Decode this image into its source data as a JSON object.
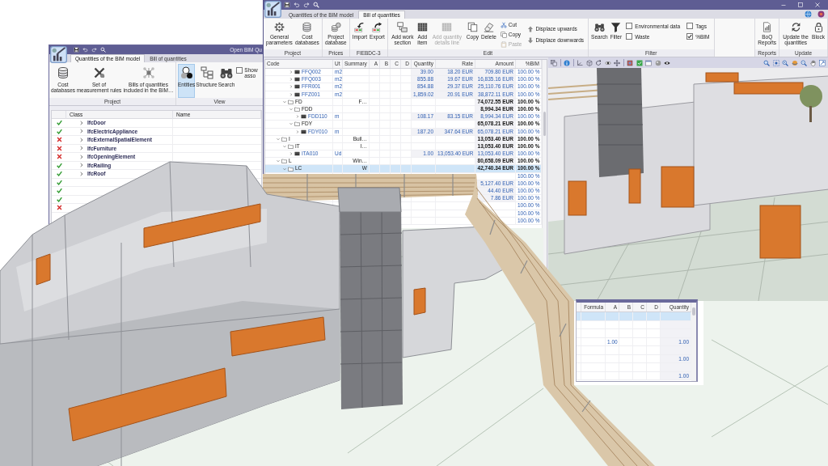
{
  "left_window": {
    "title": "Open BIM Qu",
    "tabs": [
      {
        "label": "Quantities of the BIM model",
        "selected": true
      },
      {
        "label": "Bill of quantities",
        "selected": false
      }
    ],
    "ribbon": [
      {
        "label": "Project",
        "buttons": [
          {
            "label": "Cost databases"
          },
          {
            "label": "Set of measurement rules"
          },
          {
            "label": "Bills of quantities included in the BIM…"
          }
        ]
      },
      {
        "label": "View",
        "buttons": [
          {
            "label": "Entities",
            "selected": true
          },
          {
            "label": "Structure",
            "selected": false
          },
          {
            "label": "Search",
            "selected": false
          }
        ],
        "checkbox": {
          "label": "Show asso",
          "checked": false
        }
      }
    ],
    "table": {
      "columns": [
        "Class",
        "Name"
      ],
      "rows": [
        {
          "valid": true,
          "expanded": false,
          "class": "IfcDoor"
        },
        {
          "valid": true,
          "expanded": false,
          "class": "IfcElectricAppliance"
        },
        {
          "valid": false,
          "expanded": false,
          "class": "IfcExternalSpatialElement"
        },
        {
          "valid": false,
          "expanded": false,
          "class": "IfcFurniture"
        },
        {
          "valid": false,
          "expanded": false,
          "class": "IfcOpeningElement"
        },
        {
          "valid": true,
          "expanded": false,
          "class": "IfcRailing"
        },
        {
          "valid": true,
          "expanded": false,
          "class": "IfcRoof"
        },
        {
          "valid": true
        },
        {
          "valid": true
        },
        {
          "valid": true
        },
        {
          "valid": false
        }
      ]
    }
  },
  "right_window": {
    "tabs": [
      {
        "label": "Quantities of the BIM model",
        "selected": false
      },
      {
        "label": "Bill of quantities",
        "selected": true
      }
    ],
    "ribbon": [
      {
        "label": "Project",
        "buttons": [
          {
            "label": "General parameters"
          },
          {
            "label": "Cost databases"
          }
        ]
      },
      {
        "label": "Prices",
        "buttons": [
          {
            "label": "Project database"
          }
        ]
      },
      {
        "label": "FIEBDC-3",
        "buttons": [
          {
            "label": "Import"
          },
          {
            "label": "Export"
          }
        ]
      },
      {
        "label": "Edit",
        "buttons": [
          {
            "label": "Add work section",
            "disabled": false
          },
          {
            "label": "Add item",
            "disabled": false
          },
          {
            "label": "Add quantity details line",
            "disabled": true
          },
          {
            "label": "Copy",
            "disabled": false
          },
          {
            "label": "Delete",
            "disabled": false
          }
        ],
        "small_buttons": [
          {
            "label": "Cut",
            "disabled": false
          },
          {
            "label": "Copy",
            "disabled": false
          },
          {
            "label": "Paste",
            "disabled": true
          }
        ],
        "move_buttons": [
          {
            "label": "Displace upwards"
          },
          {
            "label": "Displace downwards"
          }
        ]
      },
      {
        "label": "Filter",
        "buttons": [
          {
            "label": "Search"
          },
          {
            "label": "Filter"
          }
        ],
        "checkboxes": [
          {
            "label": "Environmental data",
            "checked": false
          },
          {
            "label": "Waste",
            "checked": false
          },
          {
            "label": "Tags",
            "checked": false
          },
          {
            "label": "%BIM",
            "checked": true
          }
        ]
      },
      {
        "label": "Reports",
        "buttons": [
          {
            "label": "BoQ Reports"
          }
        ]
      },
      {
        "label": "Update",
        "buttons": [
          {
            "label": "Update the quantities"
          },
          {
            "label": "Block"
          }
        ]
      }
    ],
    "table": {
      "columns": [
        "Code",
        "Ut",
        "Summary",
        "A",
        "B",
        "C",
        "D",
        "Quantity",
        "Rate",
        "Amount",
        "%BIM"
      ],
      "tree": [
        {
          "children": [
            {
              "children": [
                {
                  "kind": "item",
                  "expanded": false,
                  "selected": false,
                  "code": "FFQ002",
                  "ut": "m2",
                  "quantity": "39.00",
                  "rate": "18.20 EUR",
                  "amount": "709.80 EUR",
                  "bim": "100.00 %"
                },
                {
                  "kind": "item",
                  "expanded": false,
                  "selected": false,
                  "code": "FFQ003",
                  "ut": "m2",
                  "quantity": "855.88",
                  "rate": "19.67 EUR",
                  "amount": "16,835.16 EUR",
                  "bim": "100.00 %"
                },
                {
                  "kind": "item",
                  "expanded": false,
                  "selected": false,
                  "code": "FFR001",
                  "ut": "m2",
                  "quantity": "854.88",
                  "rate": "29.37 EUR",
                  "amount": "25,110.76 EUR",
                  "bim": "100.00 %"
                },
                {
                  "kind": "item",
                  "expanded": false,
                  "selected": false,
                  "code": "FFZ001",
                  "ut": "m2",
                  "quantity": "1,859.02",
                  "rate": "20.91 EUR",
                  "amount": "38,872.11 EUR",
                  "bim": "100.00 %"
                }
              ]
            },
            {
              "kind": "chapter",
              "expanded": true,
              "selected": false,
              "code": "FD",
              "summary": "F…",
              "amount": "74,072.55 EUR",
              "bim": "100.00 %",
              "children": [
                {
                  "kind": "chapter",
                  "expanded": true,
                  "selected": false,
                  "code": "FDD",
                  "amount": "8,994.34 EUR",
                  "bim": "100.00 %",
                  "children": [
                    {
                      "kind": "item",
                      "expanded": false,
                      "selected": false,
                      "code": "FDD110",
                      "ut": "m",
                      "quantity": "108.17",
                      "rate": "83.15 EUR",
                      "amount": "8,994.34 EUR",
                      "bim": "100.00 %"
                    }
                  ]
                },
                {
                  "kind": "chapter",
                  "expanded": true,
                  "selected": false,
                  "code": "FDY",
                  "amount": "65,078.21 EUR",
                  "bim": "100.00 %",
                  "children": [
                    {
                      "kind": "item",
                      "expanded": false,
                      "selected": false,
                      "code": "FDY010",
                      "ut": "m",
                      "quantity": "187.20",
                      "rate": "347.64 EUR",
                      "amount": "65,078.21 EUR",
                      "bim": "100.00 %"
                    }
                  ]
                }
              ]
            }
          ]
        },
        {
          "kind": "chapter",
          "expanded": true,
          "selected": false,
          "code": "I",
          "summary": "Buil…",
          "amount": "13,053.40 EUR",
          "bim": "100.00 %",
          "children": [
            {
              "kind": "chapter",
              "expanded": true,
              "selected": false,
              "code": "IT",
              "summary": "I…",
              "amount": "13,053.40 EUR",
              "bim": "100.00 %",
              "children": [
                {
                  "kind": "item",
                  "expanded": false,
                  "selected": false,
                  "code": "ITA010",
                  "ut": "Ud",
                  "quantity": "1.00",
                  "rate": "13,053.40 EUR",
                  "amount": "13,053.40 EUR",
                  "bim": "100.00 %"
                }
              ]
            }
          ]
        },
        {
          "kind": "chapter",
          "expanded": true,
          "selected": false,
          "code": "L",
          "summary": "Win…",
          "amount": "80,658.09 EUR",
          "bim": "100.00 %",
          "children": [
            {
              "kind": "chapter",
              "expanded": true,
              "selected": true,
              "code": "LC",
              "summary": "W",
              "amount": "42,740.34 EUR",
              "bim": "100.00 %",
              "children": [
                {
                  "bim": "100.00 %"
                },
                {
                  "amount": "5,127.40 EUR",
                  "bim": "100.00 %"
                },
                {
                  "amount": "44.40 EUR",
                  "bim": "100.00 %"
                },
                {
                  "amount": "7.86 EUR",
                  "bim": "100.00 %"
                },
                {
                  "bim": "100.00 %"
                },
                {
                  "bim": "100.00 %"
                },
                {
                  "bim": "100.00 %"
                }
              ]
            }
          ]
        }
      ]
    },
    "lower_table": {
      "columns": [
        "Formula",
        "A",
        "B",
        "C",
        "D",
        "Quantity"
      ],
      "rows": [
        {
          "selected": true
        },
        {
          "selected": false
        },
        {
          "selected": false
        },
        {
          "selected": false,
          "a": "1.00",
          "quantity": "1.00"
        },
        {
          "selected": false
        },
        {
          "selected": false,
          "quantity": "1.00"
        },
        {
          "selected": false
        },
        {
          "selected": false,
          "quantity": "1.00"
        }
      ]
    }
  }
}
